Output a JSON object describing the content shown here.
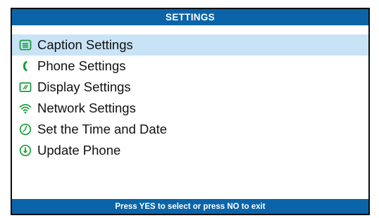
{
  "title": "SETTINGS",
  "menu": {
    "items": [
      {
        "label": "Caption Settings",
        "icon": "caption-icon",
        "selected": true
      },
      {
        "label": "Phone Settings",
        "icon": "phone-handset-icon"
      },
      {
        "label": "Display Settings",
        "icon": "display-icon"
      },
      {
        "label": "Network Settings",
        "icon": "wifi-icon"
      },
      {
        "label": "Set the Time and Date",
        "icon": "clock-icon"
      },
      {
        "label": "Update Phone",
        "icon": "download-icon"
      }
    ]
  },
  "footer": {
    "hint": "Press YES to select or press NO to exit"
  },
  "colors": {
    "bar": "#0b64a8",
    "icon_green": "#1a9e3c",
    "selection": "#c9e3f6"
  }
}
